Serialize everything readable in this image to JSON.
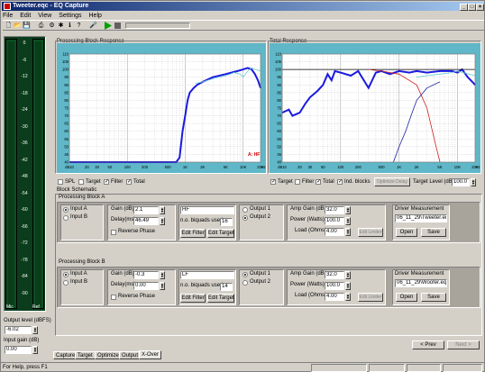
{
  "window": {
    "title": "Tweeter.eqc - EQ Capture"
  },
  "menu": [
    "File",
    "Edit",
    "View",
    "Settings",
    "Help"
  ],
  "toolbar": {
    "icons": [
      "new-icon",
      "open-icon",
      "save-icon",
      "print-icon",
      "wizard-icon",
      "help-icon",
      "microphone-icon",
      "play-icon",
      "stop-icon"
    ]
  },
  "left": {
    "meter_scale": [
      "0",
      "-6",
      "-12",
      "-18",
      "-24",
      "-30",
      "-36",
      "-42",
      "-48",
      "-54",
      "-60",
      "-66",
      "-72",
      "-78",
      "-84",
      "-90"
    ],
    "meter_labels": {
      "left": "Mic",
      "right": "Ref"
    },
    "output_level_label": "Output level (dBFS)",
    "output_level_value": "-6.02",
    "input_gain_label": "Input gain (dB)",
    "input_gain_value": "0.00"
  },
  "proc_response": {
    "title": "Processing Block Response",
    "annotation": "A: HF",
    "x_ticks": [
      "dB10",
      "20",
      "30",
      "50",
      "100",
      "200",
      "500",
      "1K",
      "2K",
      "5K",
      "10K",
      "20K",
      "Hz"
    ],
    "y_ticks": [
      "110",
      "105",
      "100",
      "95",
      "90",
      "85",
      "80",
      "75",
      "70",
      "65",
      "60",
      "55",
      "50",
      "45",
      "40"
    ],
    "checks": [
      {
        "label": "SPL",
        "checked": false
      },
      {
        "label": "Target",
        "checked": false
      },
      {
        "label": "Filter",
        "checked": true
      },
      {
        "label": "Total",
        "checked": true
      }
    ]
  },
  "total_response": {
    "title": "Total Response",
    "x_ticks": [
      "dB10",
      "20",
      "30",
      "50",
      "100",
      "200",
      "500",
      "1K",
      "2K",
      "5K",
      "10K",
      "20K",
      "Hz"
    ],
    "y_ticks": [
      "110",
      "105",
      "100",
      "95",
      "90",
      "85",
      "80",
      "75",
      "70",
      "65",
      "60",
      "55",
      "50",
      "45",
      "40"
    ],
    "checks": [
      {
        "label": "Target",
        "checked": true
      },
      {
        "label": "Filter",
        "checked": false
      },
      {
        "label": "Total",
        "checked": true
      },
      {
        "label": "Ind. blocks",
        "checked": true
      }
    ],
    "optimize_button": "Optimize Delay",
    "target_level_label": "Target Level (dB)",
    "target_level_value": "100.0"
  },
  "chart_data": [
    {
      "type": "line",
      "title": "Processing Block Response",
      "x_scale": "log",
      "x_range": [
        10,
        20000
      ],
      "y_range": [
        40,
        110
      ],
      "grid": true,
      "series": [
        {
          "color": "#1a1ae0",
          "x": [
            10,
            100,
            300,
            500,
            700,
            800,
            900,
            1000,
            1100,
            1200,
            1400,
            1600,
            2000,
            3000,
            5000,
            8000,
            10000,
            12000,
            14000,
            16000,
            18000,
            20000
          ],
          "y": [
            40,
            40,
            40,
            40,
            40,
            43,
            60,
            70,
            80,
            85,
            88,
            90,
            92,
            95,
            97,
            99,
            100,
            101,
            100,
            97,
            93,
            88
          ]
        },
        {
          "color": "#66cccc",
          "x": [
            1500,
            2000,
            3000,
            5000,
            7000,
            9000,
            10000,
            12000,
            14000,
            16000,
            20000
          ],
          "y": [
            91,
            92,
            94,
            96,
            98,
            97,
            95,
            99,
            101,
            100,
            99
          ]
        }
      ]
    },
    {
      "type": "line",
      "title": "Total Response",
      "x_scale": "log",
      "x_range": [
        10,
        20000
      ],
      "y_range": [
        40,
        110
      ],
      "grid": true,
      "series": [
        {
          "color": "#1a1ae0",
          "x": [
            10,
            13,
            15,
            20,
            25,
            30,
            40,
            50,
            60,
            70,
            80,
            100,
            150,
            200,
            300,
            400,
            500,
            700,
            1000,
            1500,
            2000,
            3000,
            5000,
            8000,
            10000,
            12000,
            15000,
            18000,
            20000
          ],
          "y": [
            72,
            74,
            70,
            72,
            78,
            82,
            86,
            90,
            97,
            93,
            99,
            98,
            96,
            99,
            88,
            98,
            99,
            97,
            99,
            98,
            99,
            98,
            99,
            99,
            98,
            100,
            95,
            92,
            90
          ]
        },
        {
          "color": "#000000",
          "x": [
            10,
            20000
          ],
          "y": [
            100,
            100
          ]
        },
        {
          "color": "#cc2020",
          "x": [
            300,
            500,
            1000,
            2000,
            3000,
            4000,
            5000
          ],
          "y": [
            100,
            99,
            97,
            90,
            75,
            55,
            40
          ]
        },
        {
          "color": "#2020a0",
          "x": [
            800,
            1000,
            1300,
            1600,
            2000,
            3000,
            5000
          ],
          "y": [
            40,
            50,
            60,
            70,
            80,
            88,
            92
          ]
        },
        {
          "color": "#66cccc",
          "x": [
            2000,
            3000,
            5000,
            8000,
            10000,
            20000
          ],
          "y": [
            95,
            96,
            97,
            98,
            99,
            96
          ]
        }
      ]
    }
  ],
  "schematic": {
    "title": "Block Schematic"
  },
  "blocks": [
    {
      "title": "Processing Block A",
      "input_a": "Input A",
      "input_b": "Input B",
      "input_selected": "A",
      "gain_label": "Gain (dB)",
      "gain_value": "2.1",
      "delay_label": "Delay(ms)",
      "delay_value": "46.49",
      "reverse_label": "Reverse Phase",
      "filter_name": "HF",
      "biquads_label": "n.o. biquads used",
      "biquads_value": "16",
      "edit_filter": "Edit Filter",
      "edit_target": "Edit Target",
      "output_1": "Output 1",
      "output_2": "Output 2",
      "output_selected": "2",
      "amp_gain_label": "Amp Gain (dB)",
      "amp_gain_value": "32.0",
      "power_label": "Power (Watts)",
      "power_value": "100.0",
      "load_label": "Load (Ohms)",
      "load_value": "4.00",
      "limiter_label": "Edit Limiter",
      "driver_label": "Driver Measurement",
      "driver_file": "06_11_29\\Tweeter.eqc",
      "open": "Open",
      "save": "Save"
    },
    {
      "title": "Processing Block B",
      "input_a": "Input A",
      "input_b": "Input B",
      "input_selected": "A",
      "gain_label": "Gain (dB)",
      "gain_value": "-0.3",
      "delay_label": "Delay(ms)",
      "delay_value": "0.00",
      "reverse_label": "Reverse Phase",
      "filter_name": "LF",
      "biquads_label": "n.o. biquads used",
      "biquads_value": "14",
      "edit_filter": "Edit Filter",
      "edit_target": "Edit Target",
      "output_1": "Output 1",
      "output_2": "Output 2",
      "output_selected": "1",
      "amp_gain_label": "Amp Gain (dB)",
      "amp_gain_value": "32.0",
      "power_label": "Power (Watts)",
      "power_value": "100.0",
      "load_label": "Load (Ohms)",
      "load_value": "4.00",
      "limiter_label": "Edit Limiter",
      "driver_label": "Driver Measurement",
      "driver_file": "06_11_29\\Woofer.eqc",
      "open": "Open",
      "save": "Save"
    }
  ],
  "nav": {
    "prev": "< Prev",
    "next": "Next >"
  },
  "tabs": [
    "Capture",
    "Target",
    "Optimize",
    "Output",
    "X-Over"
  ],
  "active_tab": "X-Over",
  "status": {
    "text": "For Help, press F1"
  }
}
